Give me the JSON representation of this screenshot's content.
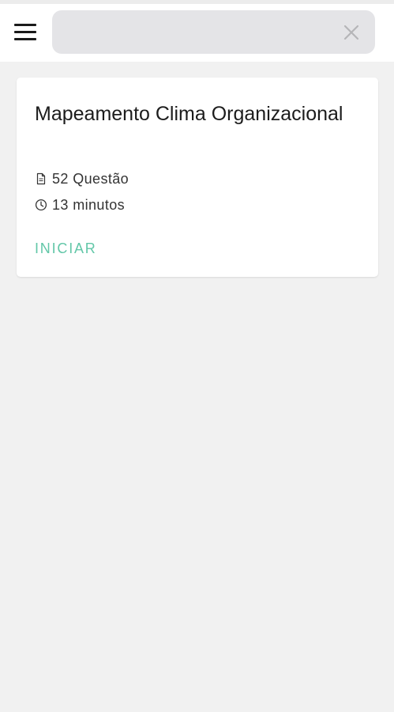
{
  "header": {
    "menu_icon": "hamburger-menu-icon",
    "search": {
      "value": "",
      "placeholder": ""
    },
    "clear_icon": "close-icon"
  },
  "quiz_card": {
    "title": "Mapeamento Clima Organizacional",
    "questions_icon": "document-icon",
    "questions_text": "52 Questão",
    "duration_icon": "clock-icon",
    "duration_text": "13 minutos",
    "start_label": "INICIAR"
  },
  "colors": {
    "background": "#f1f1f1",
    "surface": "#ffffff",
    "search_fill": "#e4e4e7",
    "accent": "#62c7a8",
    "text_primary": "#1c1c1c",
    "icon_muted": "#b5b5b8"
  }
}
